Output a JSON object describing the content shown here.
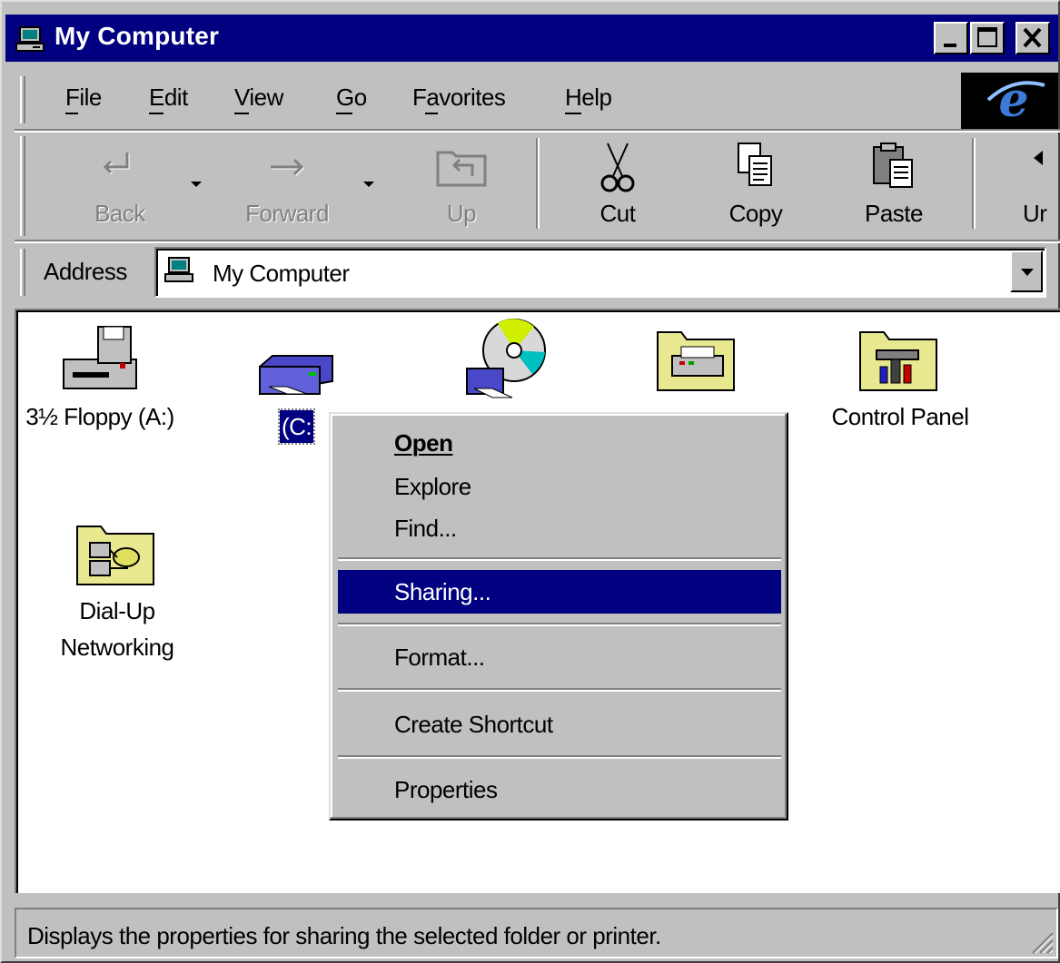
{
  "window": {
    "title": "My Computer",
    "controls": [
      "minimize-icon",
      "maximize-icon",
      "close-icon"
    ]
  },
  "menubar": {
    "items": [
      {
        "label": "File",
        "mnemonic": "F"
      },
      {
        "label": "Edit",
        "mnemonic": "E"
      },
      {
        "label": "View",
        "mnemonic": "V"
      },
      {
        "label": "Go",
        "mnemonic": "G"
      },
      {
        "label": "Favorites",
        "mnemonic": "a"
      },
      {
        "label": "Help",
        "mnemonic": "H"
      }
    ]
  },
  "toolbar": {
    "back_label": "Back",
    "forward_label": "Forward",
    "up_label": "Up",
    "cut_label": "Cut",
    "copy_label": "Copy",
    "paste_label": "Paste",
    "undo_label": "Ur"
  },
  "address": {
    "label": "Address",
    "value": "My Computer"
  },
  "icons": [
    {
      "label": "3½ Floppy (A:)",
      "icon": "floppy-drive-icon"
    },
    {
      "label": "(C:",
      "icon": "hard-drive-icon",
      "selected": true
    },
    {
      "label": "",
      "icon": "cd-drive-icon"
    },
    {
      "label": "",
      "icon": "printers-folder-icon"
    },
    {
      "label": "Control Panel",
      "icon": "control-panel-icon"
    },
    {
      "label_line1": "Dial-Up",
      "label_line2": "Networking",
      "icon": "dial-up-networking-icon"
    }
  ],
  "context_menu": {
    "items": [
      {
        "label": "Open",
        "mnemonic": "O",
        "bold": true
      },
      {
        "label": "Explore",
        "mnemonic": "E"
      },
      {
        "label": "Find...",
        "mnemonic": "F"
      },
      {
        "label": "Sharing...",
        "mnemonic": "h",
        "highlighted": true
      },
      {
        "label": "Format...",
        "mnemonic": "m"
      },
      {
        "label": "Create Shortcut",
        "mnemonic": "S"
      },
      {
        "label": "Properties",
        "mnemonic": "r"
      }
    ]
  },
  "statusbar": {
    "text": "Displays the properties for sharing the selected folder or printer."
  },
  "colors": {
    "titlebar": "#000080",
    "face": "#c0c0c0",
    "highlight": "#000080",
    "window_bg": "#ffffff"
  }
}
